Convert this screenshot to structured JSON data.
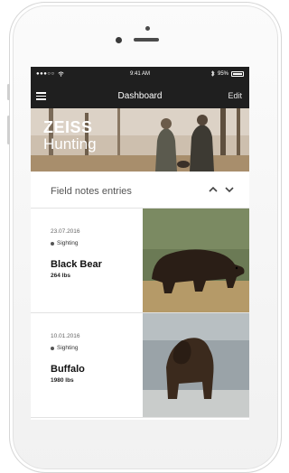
{
  "status_bar": {
    "carrier": "●●●○○",
    "time": "9:41 AM",
    "battery_text": "95%",
    "battery_level": 0.95
  },
  "nav": {
    "title": "Dashboard",
    "edit_label": "Edit"
  },
  "hero": {
    "brand_top": "ZEISS",
    "brand_bottom": "Hunting"
  },
  "field_notes": {
    "title": "Field notes  entries",
    "entries": [
      {
        "date": "23.07.2016",
        "type": "Sighting",
        "animal": "Black Bear",
        "weight": "264 lbs"
      },
      {
        "date": "10.01.2016",
        "type": "Sighting",
        "animal": "Buffalo",
        "weight": "1980 lbs"
      }
    ]
  },
  "icons": {
    "menu": "hamburger-menu-icon",
    "collapse": "chevron-up-icon",
    "expand": "chevron-down-icon"
  }
}
